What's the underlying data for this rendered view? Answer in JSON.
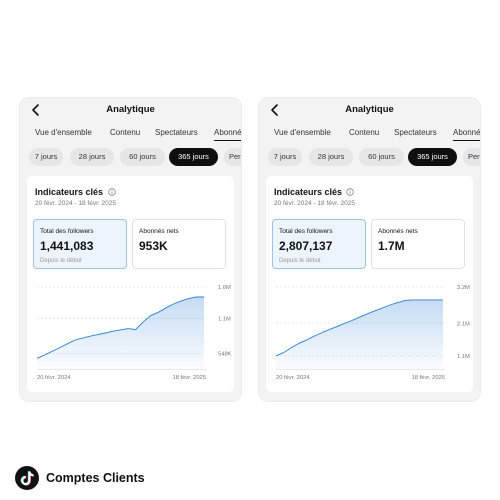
{
  "header": {
    "title": "Analytique"
  },
  "tabs": [
    "Vue d'ensemble",
    "Contenu",
    "Spectateurs",
    "Abonnés"
  ],
  "ranges": [
    "7 jours",
    "28 jours",
    "60 jours",
    "365 jours",
    "Perso"
  ],
  "indicators": {
    "title": "Indicateurs clés",
    "date_range": "20 févr. 2024 - 18 févr. 2025"
  },
  "cards": [
    {
      "total_label": "Total des followers",
      "total_value": "1,441,083",
      "since_label": "Depuis le début",
      "net_label": "Abonnés nets",
      "net_value": "953K",
      "chart_data": {
        "type": "area",
        "x_labels": [
          "20 févr. 2024",
          "18 févr. 2025"
        ],
        "y_ticks": [
          "1.6M",
          "1.1M",
          "548K"
        ],
        "y_tick_values": [
          1600000,
          1100000,
          548000
        ],
        "ylim": [
          300000,
          1600000
        ],
        "values": [
          470000,
          520000,
          580000,
          640000,
          700000,
          760000,
          790000,
          820000,
          845000,
          870000,
          900000,
          920000,
          940000,
          925000,
          1050000,
          1150000,
          1200000,
          1270000,
          1330000,
          1380000,
          1420000,
          1441083,
          1441083
        ],
        "grid": true,
        "color": "#2e7fd6"
      }
    },
    {
      "total_label": "Total des followers",
      "total_value": "2,807,137",
      "since_label": "Depuis le début",
      "net_label": "Abonnés nets",
      "net_value": "1.7M",
      "chart_data": {
        "type": "area",
        "x_labels": [
          "20 févr. 2024",
          "18 févr. 2025"
        ],
        "y_ticks": [
          "3.2M",
          "2.1M",
          "1.1M"
        ],
        "y_tick_values": [
          3200000,
          2100000,
          1100000
        ],
        "ylim": [
          700000,
          3200000
        ],
        "values": [
          1100000,
          1200000,
          1350000,
          1480000,
          1580000,
          1700000,
          1800000,
          1900000,
          1990000,
          2090000,
          2180000,
          2280000,
          2380000,
          2470000,
          2560000,
          2650000,
          2720000,
          2790000,
          2807137,
          2807137,
          2807137,
          2807137,
          2807137
        ],
        "grid": true,
        "color": "#2e7fd6"
      }
    }
  ],
  "brand": {
    "name": "Comptes Clients",
    "icon": "tiktok-logo-icon"
  }
}
